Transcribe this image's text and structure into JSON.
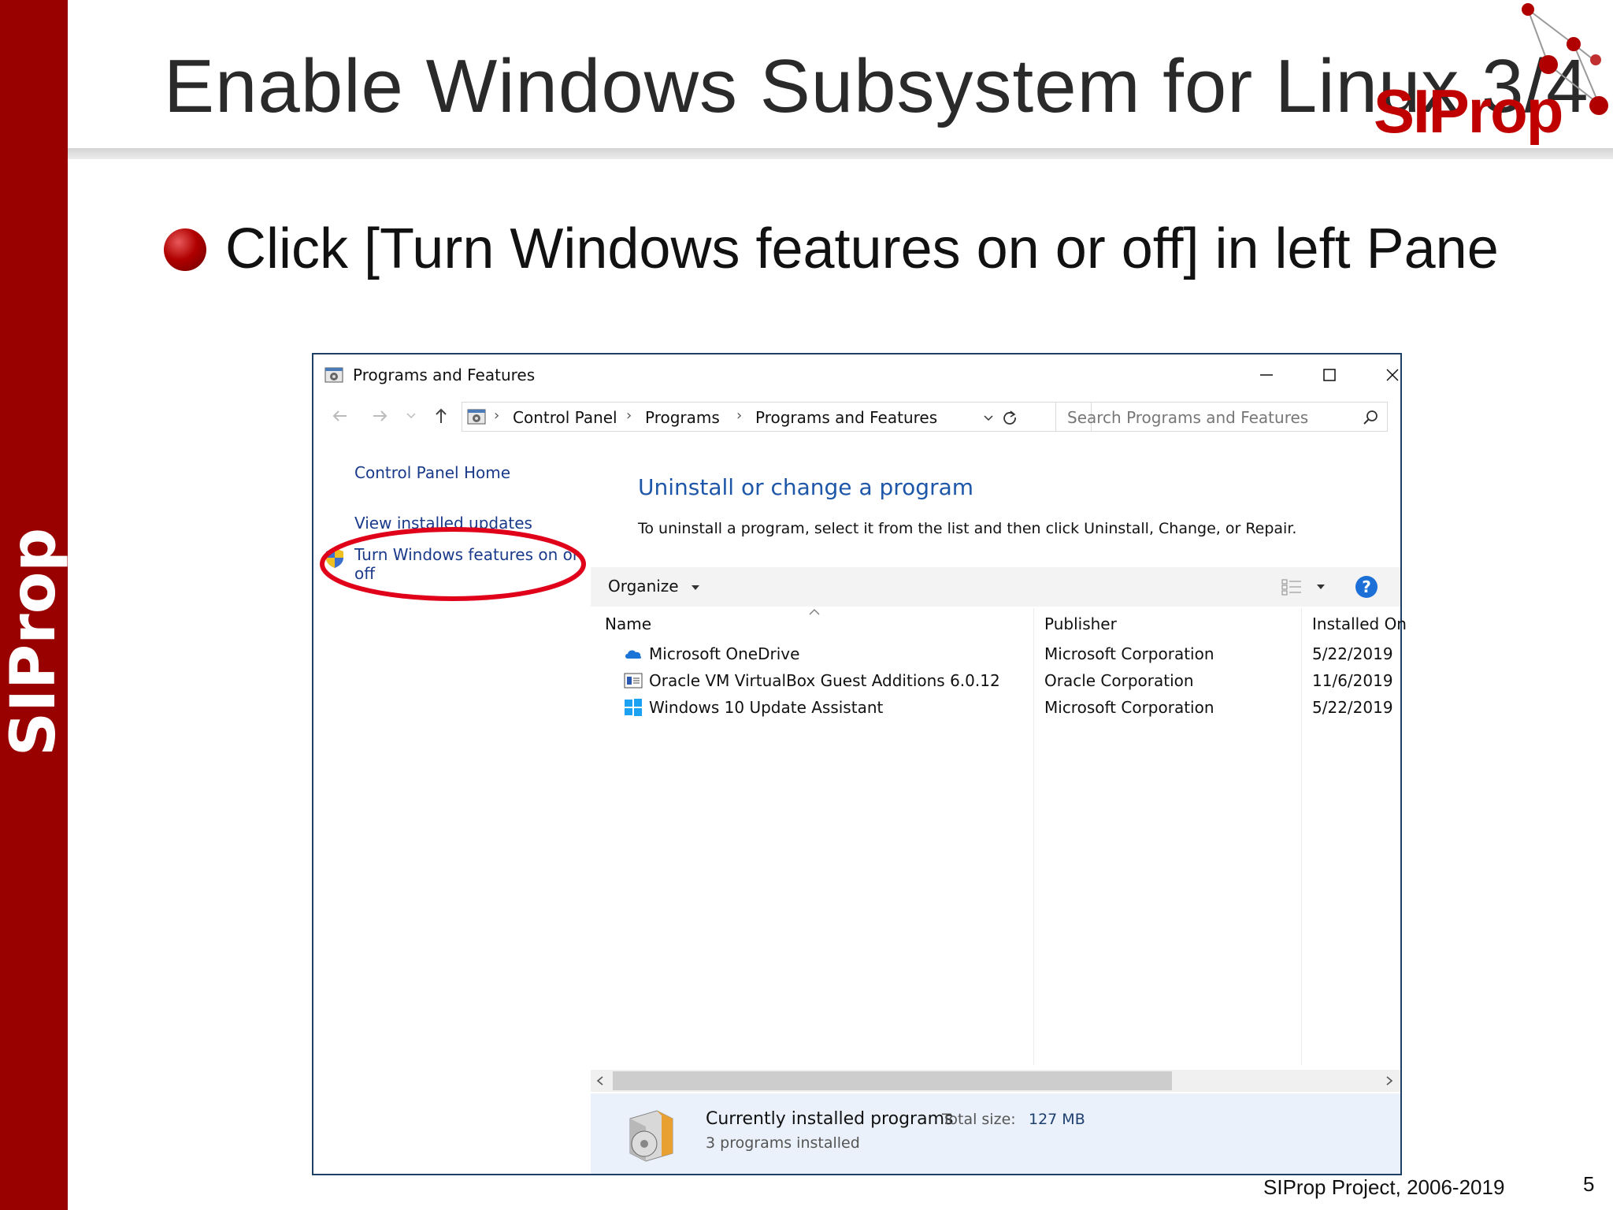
{
  "slide": {
    "side_label": "SIProp",
    "title": "Enable Windows Subsystem for Linux 3/4",
    "logo_text": "SIProp",
    "bullet_text": "Click [Turn Windows features on or off] in left Pane",
    "footer": "SIProp Project, 2006-2019",
    "page_number": "5",
    "accent_color": "#990000"
  },
  "window": {
    "title": "Programs and Features",
    "controls": {
      "minimize": "—",
      "maximize": "☐",
      "close": "✕"
    },
    "breadcrumb": [
      "Control Panel",
      "Programs",
      "Programs and Features"
    ],
    "search_placeholder": "Search Programs and Features",
    "left_pane": {
      "home": "Control Panel Home",
      "updates": "View installed updates",
      "features_line1": "Turn Windows features on or",
      "features_line2": "off"
    },
    "heading": "Uninstall or change a program",
    "description": "To uninstall a program, select it from the list and then click Uninstall, Change, or Repair.",
    "toolbar": {
      "organize": "Organize"
    },
    "columns": {
      "name": "Name",
      "publisher": "Publisher",
      "installed_on": "Installed On"
    },
    "programs": [
      {
        "name": "Microsoft OneDrive",
        "publisher": "Microsoft Corporation",
        "installed_on": "5/22/2019",
        "icon": "onedrive-icon"
      },
      {
        "name": "Oracle VM VirtualBox Guest Additions 6.0.12",
        "publisher": "Oracle Corporation",
        "installed_on": "11/6/2019",
        "icon": "virtualbox-icon"
      },
      {
        "name": "Windows 10 Update Assistant",
        "publisher": "Microsoft Corporation",
        "installed_on": "5/22/2019",
        "icon": "windows-icon"
      }
    ],
    "details": {
      "title": "Currently installed programs",
      "total_label": "Total size:",
      "total_size": "127 MB",
      "count": "3 programs installed"
    }
  }
}
